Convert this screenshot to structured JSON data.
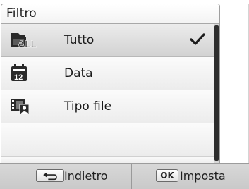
{
  "dialog": {
    "title": "Filtro",
    "items": [
      {
        "label": "Tutto",
        "icon": "all-files-icon",
        "selected": true
      },
      {
        "label": "Data",
        "icon": "calendar-icon",
        "selected": false
      },
      {
        "label": "Tipo file",
        "icon": "file-type-icon",
        "selected": false
      }
    ]
  },
  "softkeys": {
    "back": {
      "key_icon": "back-arrow-icon",
      "label": "Indietro"
    },
    "ok": {
      "key_text": "OK",
      "label": "Imposta"
    }
  },
  "colors": {
    "selected_row": "#d6d6d6",
    "scroll_thumb": "#2d2d2d",
    "bottom_bar": "#cfcfcf"
  }
}
